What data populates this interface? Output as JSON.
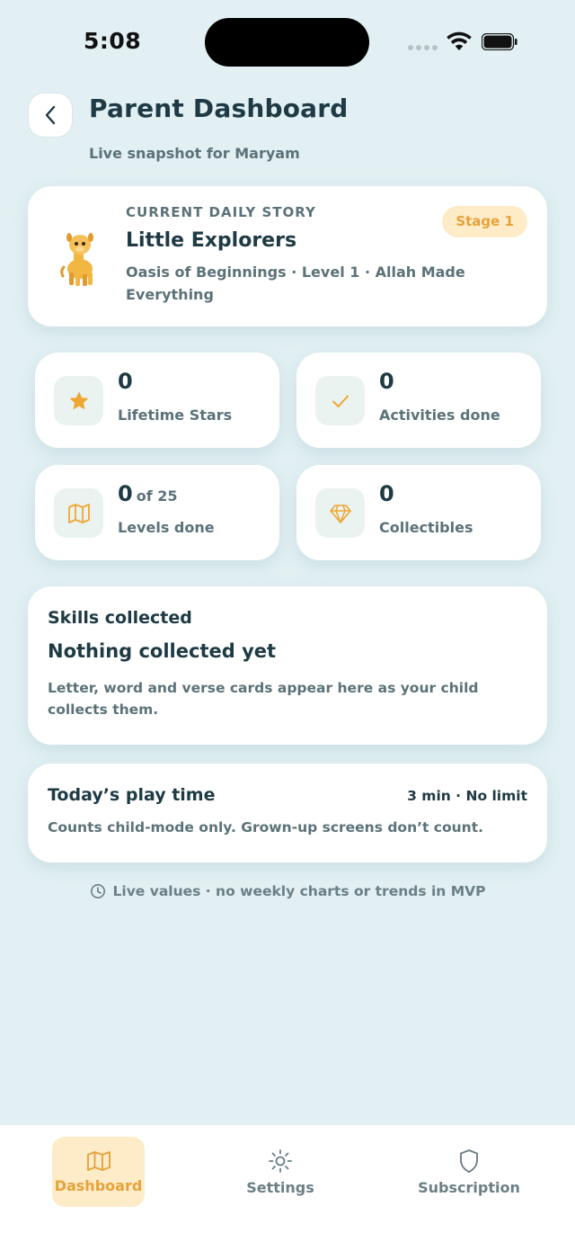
{
  "status_bar": {
    "time": "5:08"
  },
  "header": {
    "title": "Parent Dashboard",
    "subtitle": "Live snapshot for Maryam"
  },
  "story": {
    "eyebrow": "CURRENT DAILY STORY",
    "title": "Little Explorers",
    "description": "Oasis of Beginnings · Level 1 · Allah Made Everything",
    "badge": "Stage 1",
    "icon": "camel-icon"
  },
  "stats": {
    "stars": {
      "value": "0",
      "label": "Lifetime Stars",
      "icon": "star-icon"
    },
    "activities": {
      "value": "0",
      "label": "Activities done",
      "icon": "check-icon"
    },
    "levels": {
      "value": "0",
      "of": "of 25",
      "label": "Levels done",
      "icon": "map-icon"
    },
    "collectibles": {
      "value": "0",
      "label": "Collectibles",
      "icon": "gem-icon"
    }
  },
  "skills": {
    "heading": "Skills collected",
    "empty_title": "Nothing collected yet",
    "description": "Letter, word and verse cards appear here as your child collects them."
  },
  "play_time": {
    "heading": "Today’s play time",
    "value": "3 min · No limit",
    "description": "Counts child-mode only. Grown-up screens don’t count."
  },
  "footnote": "Live values · no weekly charts or trends in MVP",
  "tabs": [
    {
      "label": "Dashboard",
      "icon": "map-icon",
      "active": true
    },
    {
      "label": "Settings",
      "icon": "sun-gear-icon",
      "active": false
    },
    {
      "label": "Subscription",
      "icon": "shield-icon",
      "active": false
    }
  ],
  "colors": {
    "background": "#e2f0f3",
    "accent": "#e7a23a",
    "accent_soft": "#fdecc7",
    "text_primary": "#1e3a44",
    "text_secondary": "#5b7279",
    "icon_tile": "#eaf3f0"
  }
}
